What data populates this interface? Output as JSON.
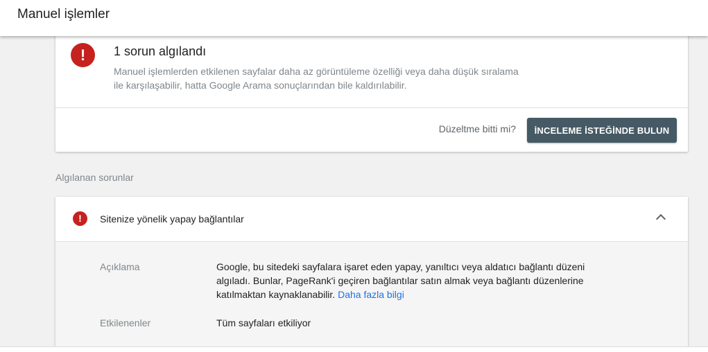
{
  "header": {
    "title": "Manuel işlemler"
  },
  "summary": {
    "alert_icon": "!",
    "title": "1 sorun algılandı",
    "description": "Manuel işlemlerden etkilenen sayfalar daha az görüntüleme özelliği veya daha düşük sıralama ile karşılaşabilir, hatta Google Arama sonuçlarından bile kaldırılabilir.",
    "fix_question": "Düzeltme bitti mi?",
    "review_button": "İNCELEME İSTEĞİNDE BULUN"
  },
  "detected_section": {
    "label": "Algılanan sorunlar"
  },
  "issue": {
    "icon": "!",
    "title": "Sitenize yönelik yapay bağlantılar",
    "rows": [
      {
        "label": "Açıklama",
        "value": "Google, bu sitedeki sayfalara işaret eden yapay, yanıltıcı veya aldatıcı bağlantı düzeni algıladı. Bunlar, PageRank'i geçiren bağlantılar satın almak veya bağlantı düzenlerine katılmaktan kaynaklanabilir.",
        "link": "Daha fazla bilgi"
      },
      {
        "label": "Etkilenenler",
        "value": "Tüm sayfaları etkiliyor"
      }
    ]
  },
  "colors": {
    "alert_red": "#c5221f",
    "button_bg": "#455a64",
    "link_blue": "#1a73e8",
    "page_bg": "#f1f1f1"
  }
}
